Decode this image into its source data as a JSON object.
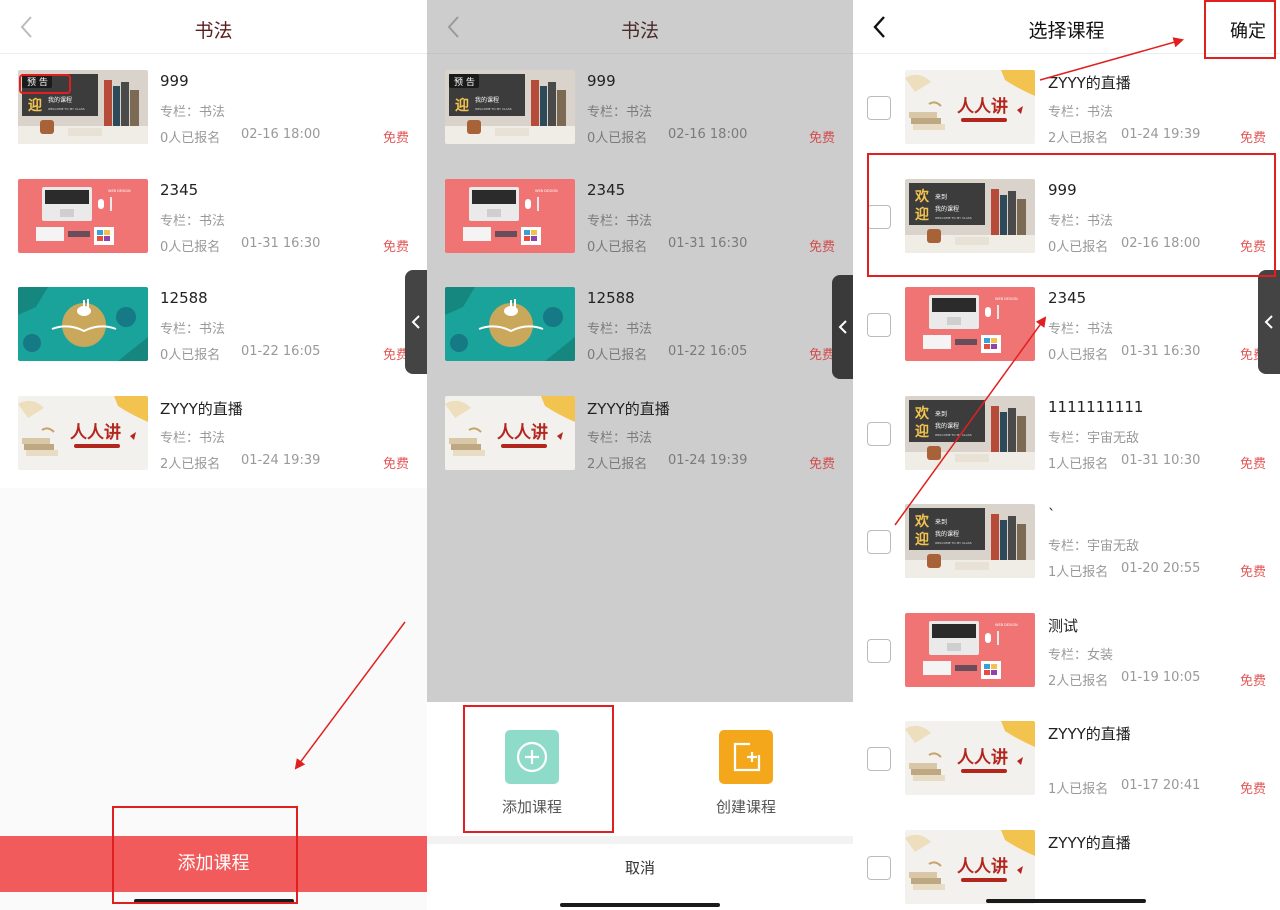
{
  "colors": {
    "accent": "#f15b5b",
    "price": "#e25757",
    "annotation": "#e02020"
  },
  "panel1": {
    "title": "书法",
    "items": [
      {
        "name": "999",
        "column": "专栏：书法",
        "count": "0人已报名",
        "time": "02-16 18:00",
        "price": "免费",
        "thumb": "welcome-books",
        "badge": "预 告"
      },
      {
        "name": "2345",
        "column": "专栏：书法",
        "count": "0人已报名",
        "time": "01-31 16:30",
        "price": "免费",
        "thumb": "laptop-desk"
      },
      {
        "name": "12588",
        "column": "专栏：书法",
        "count": "0人已报名",
        "time": "01-22 16:05",
        "price": "免费",
        "thumb": "teal-moon"
      },
      {
        "name": "ZYYY的直播",
        "column": "专栏：书法",
        "count": "2人已报名",
        "time": "01-24 19:39",
        "price": "免费",
        "thumb": "renren-jiang"
      }
    ],
    "add_button": "添加课程"
  },
  "panel2": {
    "title": "书法",
    "items": [
      {
        "name": "999",
        "column": "专栏：书法",
        "count": "0人已报名",
        "time": "02-16 18:00",
        "price": "免费",
        "thumb": "welcome-books",
        "badge": "预 告"
      },
      {
        "name": "2345",
        "column": "专栏：书法",
        "count": "0人已报名",
        "time": "01-31 16:30",
        "price": "免费",
        "thumb": "laptop-desk"
      },
      {
        "name": "12588",
        "column": "专栏：书法",
        "count": "0人已报名",
        "time": "01-22 16:05",
        "price": "免费",
        "thumb": "teal-moon"
      },
      {
        "name": "ZYYY的直播",
        "column": "专栏：书法",
        "count": "2人已报名",
        "time": "01-24 19:39",
        "price": "免费",
        "thumb": "renren-jiang"
      }
    ],
    "sheet": {
      "add_course": "添加课程",
      "create_course": "创建课程",
      "cancel": "取消",
      "add_icon": "plus-circle-icon",
      "create_icon": "plus-square-icon"
    }
  },
  "panel3": {
    "title": "选择课程",
    "confirm": "确定",
    "items": [
      {
        "name": "ZYYY的直播",
        "column": "专栏：书法",
        "count": "2人已报名",
        "time": "01-24 19:39",
        "price": "免费",
        "thumb": "renren-jiang"
      },
      {
        "name": "999",
        "column": "专栏：书法",
        "count": "0人已报名",
        "time": "02-16 18:00",
        "price": "免费",
        "thumb": "welcome-books"
      },
      {
        "name": "2345",
        "column": "专栏：书法",
        "count": "0人已报名",
        "time": "01-31 16:30",
        "price": "免费",
        "thumb": "laptop-desk"
      },
      {
        "name": "1111111111",
        "column": "专栏：宇宙无敌",
        "count": "1人已报名",
        "time": "01-31 10:30",
        "price": "免费",
        "thumb": "welcome-books"
      },
      {
        "name": "`",
        "column": "专栏：宇宙无敌",
        "count": "1人已报名",
        "time": "01-20 20:55",
        "price": "免费",
        "thumb": "welcome-books"
      },
      {
        "name": "测试",
        "column": "专栏：女装",
        "count": "2人已报名",
        "time": "01-19 10:05",
        "price": "免费",
        "thumb": "laptop-desk"
      },
      {
        "name": "ZYYY的直播",
        "column": "",
        "count": "1人已报名",
        "time": "01-17 20:41",
        "price": "免费",
        "thumb": "renren-jiang"
      },
      {
        "name": "ZYYY的直播",
        "column": "",
        "count": "",
        "time": "",
        "price": "",
        "thumb": "renren-jiang"
      }
    ]
  },
  "thumb_text": {
    "welcome_big1": "欢",
    "welcome_big2": "迎",
    "welcome_small1": "来到",
    "welcome_small2": "我的课程",
    "welcome_tiny": "WELCOME TO MY CLASS",
    "renren": "人人讲",
    "laptop_caption": "WEB DESIGN"
  }
}
